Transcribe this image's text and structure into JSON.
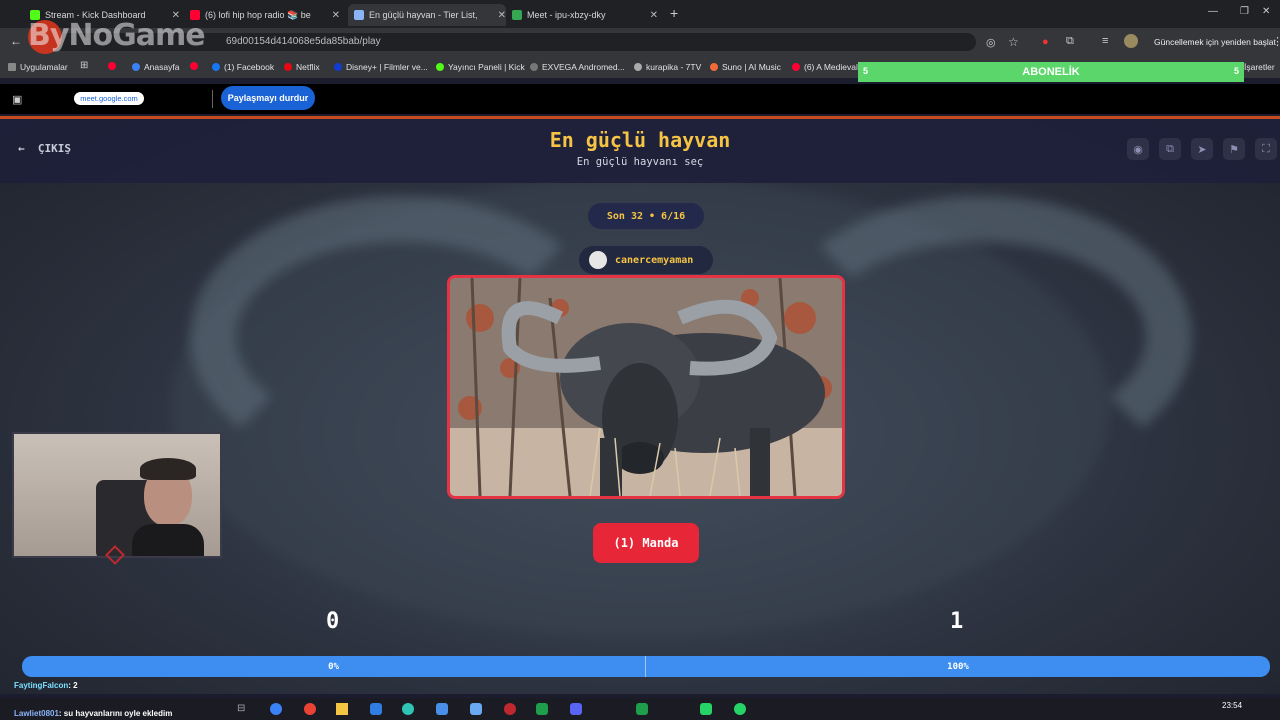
{
  "browser": {
    "tabs": [
      {
        "label": "Stream - Kick Dashboard",
        "color": "#53fc18"
      },
      {
        "label": "(6) lofi hip hop radio 📚 be",
        "color": "#ff0033"
      },
      {
        "label": "En güçlü hayvan - Tier List,",
        "color": "#8ab4f8",
        "active": true
      },
      {
        "label": "Meet - ipu-xbzy-dky",
        "color": "#34a853"
      }
    ],
    "url": "69d00154d414068e5da85bab/play",
    "update_label": "Güncellemek için yeniden başlat",
    "bookmarks": [
      "Uygulamalar",
      "Anasayfa",
      "(1) Facebook",
      "Netflix",
      "Disney+ | Filmler ve...",
      "Yayıncı Paneli | Kick",
      "EXVEGA Andromed...",
      "kurapika - 7TV",
      "Suno | AI Music",
      "(6) A Medieval"
    ],
    "bookmarks_more": "İşaretler"
  },
  "share_bar": {
    "meet_label": "meet.google.com",
    "stop_label": "Paylaşmayı durdur"
  },
  "overlay": {
    "logo": "ByNoGame",
    "sub_label": "ABONELİK",
    "sub_left": "5",
    "sub_right": "5"
  },
  "page": {
    "back_label": "ÇIKIŞ",
    "title": "En güçlü hayvan",
    "subtitle": "En güçlü hayvanı seç",
    "round_label": "Son 32 • 6/16",
    "username": "canercemyaman",
    "choice_label": "(1) Manda",
    "score_left": "0",
    "score_right": "1",
    "percent_left": "0%",
    "percent_right": "100%",
    "percent_left_value": 0,
    "percent_right_value": 100,
    "colors": {
      "accent": "#f5c445",
      "choice": "#e72638",
      "bar": "#3d8ef0"
    }
  },
  "chat": {
    "line1_user": "FaytingFalcon",
    "line1_text": ": 2",
    "line2_user": "Lawliet0801",
    "line2_text": ": su hayvanlarını oyle ekledim"
  },
  "taskbar": {
    "time": "23:54"
  }
}
